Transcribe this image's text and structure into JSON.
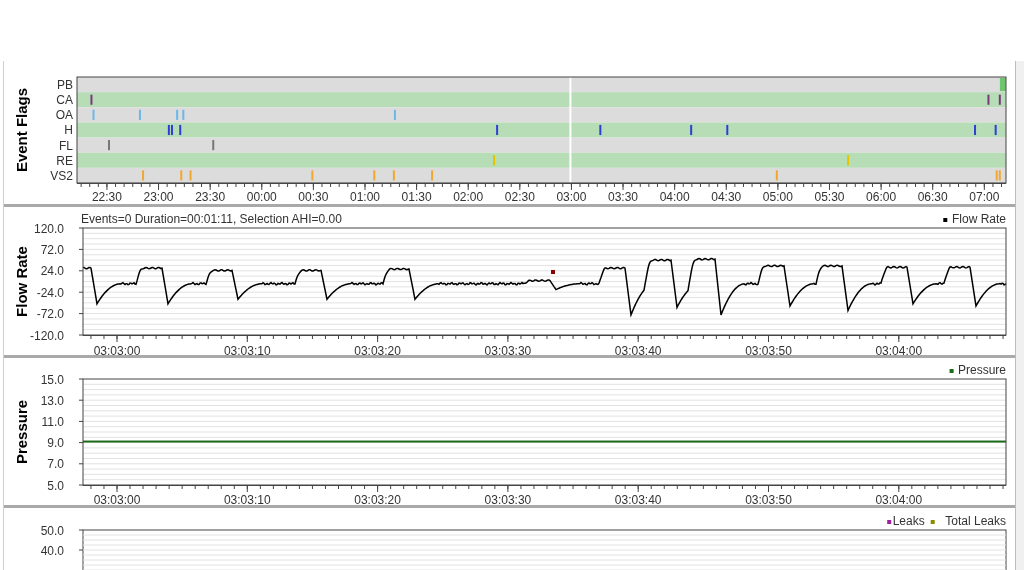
{
  "event_flags": {
    "title": "Event Flags",
    "rows": [
      {
        "label": "PB",
        "color": "#6cc76c"
      },
      {
        "label": "CA",
        "color": "#7a3a7a"
      },
      {
        "label": "OA",
        "color": "#6ab8ea"
      },
      {
        "label": "H",
        "color": "#2b3fd6"
      },
      {
        "label": "FL",
        "color": "#777777"
      },
      {
        "label": "RE",
        "color": "#e6c200"
      },
      {
        "label": "VS2",
        "color": "#f0a830"
      }
    ],
    "x_ticks": [
      "22:30",
      "23:00",
      "23:30",
      "00:00",
      "00:30",
      "01:00",
      "01:30",
      "02:00",
      "02:30",
      "03:00",
      "03:30",
      "04:00",
      "04:30",
      "05:00",
      "05:30",
      "06:00",
      "06:30",
      "07:00"
    ]
  },
  "flow_rate": {
    "title": "Flow Rate",
    "summary": "Events=0 Duration=00:01:11, Selection AHI=0.00",
    "legend": {
      "label": "Flow Rate",
      "color": "#000000"
    },
    "y_ticks": [
      "120.0",
      "72.0",
      "24.0",
      "-24.0",
      "-72.0",
      "-120.0"
    ],
    "x_ticks": [
      "03:03:00",
      "03:03:10",
      "03:03:20",
      "03:03:30",
      "03:03:40",
      "03:03:50",
      "03:04:00"
    ]
  },
  "pressure": {
    "title": "Pressure",
    "legend": {
      "label": "Pressure",
      "color": "#1a6b1a"
    },
    "y_ticks": [
      "15.0",
      "13.0",
      "11.0",
      "9.0",
      "7.0",
      "5.0"
    ],
    "x_ticks": [
      "03:03:00",
      "03:03:10",
      "03:03:20",
      "03:03:30",
      "03:03:40",
      "03:03:50",
      "03:04:00"
    ]
  },
  "leaks": {
    "legend": [
      {
        "label": "Leaks",
        "color": "#a020a0"
      },
      {
        "label": "Total Leaks",
        "color": "#8b8b00"
      }
    ],
    "y_ticks": [
      "50.0",
      "40.0"
    ]
  }
}
